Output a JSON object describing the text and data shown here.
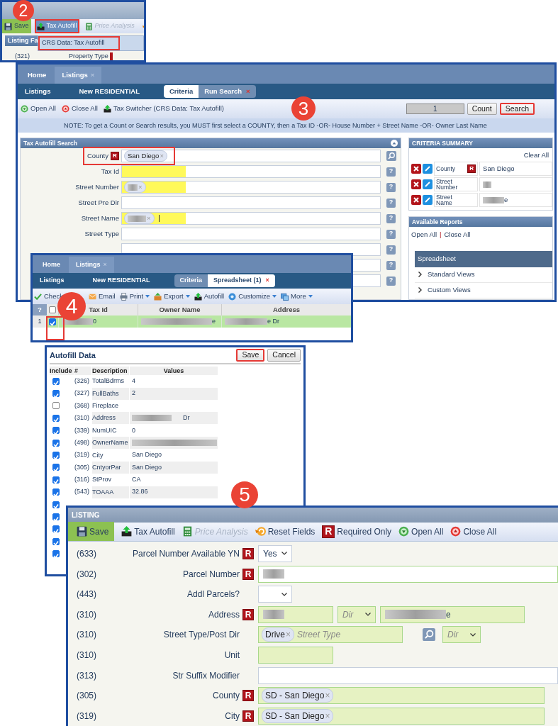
{
  "step_badges": [
    {
      "label": "2"
    },
    {
      "label": "3"
    },
    {
      "label": "4"
    },
    {
      "label": "5"
    }
  ],
  "menu_window": {
    "toolbar": [
      {
        "kind": "save",
        "label": "Save",
        "highlighted": false,
        "disabled": false
      },
      {
        "kind": "autofill",
        "label": "Tax Autofill",
        "highlighted": true,
        "disabled": false
      },
      {
        "kind": "price",
        "label": "Price Analysis",
        "highlighted": false,
        "disabled": true
      },
      {
        "kind": "reset"
      }
    ],
    "section_title": "Listing Fa",
    "menu_item": {
      "label": "CRS Data: Tax Autofill",
      "highlighted": true
    },
    "field": {
      "number": "(321)",
      "label": "Property Type"
    }
  },
  "search_window": {
    "tabs": [
      {
        "label": "Home",
        "selected": false
      },
      {
        "label": "Listings",
        "selected": true,
        "close": "×"
      }
    ],
    "subnav": [
      "Listings",
      "New RESIDENTIAL"
    ],
    "view_tabs": [
      {
        "label": "Criteria",
        "selected": true
      },
      {
        "label": "Run Search",
        "selected": false,
        "close": "×"
      }
    ],
    "toolbar": [
      {
        "kind": "open",
        "label": "Open All"
      },
      {
        "kind": "close",
        "label": "Close All"
      },
      {
        "kind": "autofill",
        "label": "Tax Switcher (CRS Data: Tax Autofill)"
      }
    ],
    "count_value": "1",
    "count_button": {
      "label": "Count",
      "highlighted": false
    },
    "search_button": {
      "label": "Search",
      "highlighted": true
    },
    "note": "NOTE: To get a Count or Search results, you MUST first select a COUNTY, then a Tax ID -OR- House Number + Street Name -OR- Owner Last Name",
    "form": {
      "title": "Tax Autofill Search",
      "fields": [
        {
          "label": "County",
          "badge": "R",
          "kind": "lookup",
          "chip": {
            "text": "San Diego",
            "remove": "×"
          },
          "highlighted": true,
          "marked": false
        },
        {
          "label": "Tax Id",
          "kind": "help",
          "help": "?",
          "highlighted": false,
          "marked": true
        },
        {
          "label": "Street Number",
          "kind": "help",
          "help": "?",
          "chip": {
            "redacted": true,
            "remove": "×"
          },
          "highlighted": false,
          "marked": true
        },
        {
          "label": "Street Pre Dir",
          "kind": "help",
          "help": "?",
          "highlighted": false,
          "marked": false
        },
        {
          "label": "Street Name",
          "kind": "help",
          "help": "?",
          "chip": {
            "redacted": true,
            "remove": "×"
          },
          "cursor": true,
          "highlighted": false,
          "marked": true
        },
        {
          "label": "Street Type",
          "kind": "help",
          "help": "?",
          "highlighted": false,
          "marked": false
        },
        {
          "kind": "help",
          "help": "?",
          "highlighted": false,
          "marked": false
        },
        {
          "kind": "help",
          "help": "?"
        },
        {
          "kind": "help",
          "help": "?"
        }
      ]
    },
    "summary": {
      "title": "CRITERIA SUMMARY",
      "clear": "Clear All",
      "rows": [
        {
          "label": "County",
          "badge": "R",
          "value": "San Diego"
        },
        {
          "label": "Street Number",
          "redacted": true
        },
        {
          "label": "Street Name",
          "redacted": true,
          "value": "e"
        }
      ]
    },
    "reports": {
      "title": "Available Reports",
      "links": [
        "Open All",
        "Close All"
      ],
      "separator": "|",
      "group": "Spreadsheet",
      "items": [
        "Standard Views",
        "Custom Views"
      ]
    }
  },
  "spreadsheet_window": {
    "tabs": [
      {
        "label": "Home",
        "selected": false
      },
      {
        "label": "Listings",
        "selected": true,
        "close": "×"
      }
    ],
    "subnav": [
      "Listings",
      "New RESIDENTIAL"
    ],
    "view_tabs": [
      {
        "label": "Criteria",
        "selected": false
      },
      {
        "label": "Spreadsheet (1)",
        "selected": true,
        "close": "×"
      }
    ],
    "toolbar": [
      {
        "kind": "check",
        "label": "Check"
      },
      {
        "kind": "email",
        "label": "Email"
      },
      {
        "kind": "print",
        "label": "Print",
        "dropdown": true
      },
      {
        "kind": "export",
        "label": "Export",
        "dropdown": true
      },
      {
        "kind": "autofill",
        "label": "Autofill"
      },
      {
        "kind": "customize",
        "label": "Customize",
        "dropdown": true
      },
      {
        "kind": "more",
        "label": "More",
        "dropdown": true
      }
    ],
    "table": {
      "help": "?",
      "all_checked": false,
      "columns": [
        "Tax Id",
        "Owner Name",
        "Address"
      ],
      "rows": [
        {
          "number": "1",
          "checked": true,
          "selected": true,
          "highlighted": true,
          "cells": [
            "0",
            "e",
            "e Dr"
          ]
        }
      ]
    }
  },
  "autofill_dialog": {
    "title": "Autofill Data",
    "save": {
      "label": "Save",
      "highlighted": true
    },
    "cancel": {
      "label": "Cancel",
      "highlighted": false
    },
    "columns": [
      "Include",
      "#",
      "Description",
      "Values"
    ],
    "rows": [
      {
        "checked": true,
        "number": "(326)",
        "description": "TotalBdrms",
        "value": "4"
      },
      {
        "checked": true,
        "number": "(327)",
        "description": "FullBaths",
        "value": "2"
      },
      {
        "checked": false,
        "number": "(368)",
        "description": "Fireplace"
      },
      {
        "checked": true,
        "number": "(310)",
        "description": "Address",
        "redacted": true,
        "value": "Dr"
      },
      {
        "checked": true,
        "number": "(339)",
        "description": "NumUIC",
        "value": "0"
      },
      {
        "checked": true,
        "number": "(498)",
        "description": "OwnerName",
        "redacted": true
      },
      {
        "checked": true,
        "number": "(319)",
        "description": "City",
        "value": "San Diego"
      },
      {
        "checked": true,
        "number": "(305)",
        "description": "CntyorPar",
        "value": "San Diego"
      },
      {
        "checked": true,
        "number": "(316)",
        "description": "StProv",
        "value": "CA"
      },
      {
        "checked": true,
        "number": "(543)",
        "description": "TOAAA",
        "value": "32.86"
      },
      {
        "checked": true
      },
      {
        "checked": true
      },
      {
        "checked": true
      },
      {
        "checked": true
      },
      {
        "checked": true
      }
    ]
  },
  "listing_window": {
    "title": "LISTING",
    "toolbar": [
      {
        "kind": "save",
        "label": "Save",
        "disabled": false
      },
      {
        "kind": "autofill",
        "label": "Tax Autofill",
        "disabled": false
      },
      {
        "kind": "price",
        "label": "Price Analysis",
        "disabled": true
      },
      {
        "kind": "reset",
        "label": "Reset Fields",
        "disabled": false
      },
      {
        "kind": "required",
        "badge": "R",
        "label": "Required Only",
        "disabled": false
      },
      {
        "kind": "open",
        "label": "Open All",
        "disabled": false
      },
      {
        "kind": "close",
        "label": "Close All",
        "disabled": false
      }
    ],
    "fields": [
      {
        "number": "(633)",
        "label": "Parcel Number Available YN",
        "badge": "R",
        "controls": [
          {
            "kind": "select",
            "value": "Yes",
            "filled": false
          }
        ]
      },
      {
        "number": "(302)",
        "label": "Parcel Number",
        "badge": "R",
        "controls": [
          {
            "kind": "input",
            "redacted": true,
            "filled": false
          }
        ]
      },
      {
        "number": "(443)",
        "label": "Addl Parcels?",
        "controls": [
          {
            "kind": "select",
            "filled": false
          }
        ]
      },
      {
        "number": "(310)",
        "label": "Address",
        "badge": "R",
        "controls": [
          {
            "kind": "input",
            "redacted": true,
            "filled": true
          },
          {
            "kind": "select",
            "placeholder": "Dir",
            "filled": true
          },
          {
            "kind": "input",
            "redacted": true,
            "value": "e",
            "filled": true
          }
        ]
      },
      {
        "number": "(310)",
        "label": "Street Type/Post Dir",
        "controls": [
          {
            "kind": "chips",
            "chip": "Drive",
            "remove": "×",
            "placeholder": "Street Type",
            "filled": true
          },
          {
            "kind": "lookup"
          },
          {
            "kind": "select",
            "placeholder": "Dir",
            "filled": true
          }
        ]
      },
      {
        "number": "(310)",
        "label": "Unit",
        "controls": [
          {
            "kind": "input",
            "filled": true
          }
        ]
      },
      {
        "number": "(313)",
        "label": "Str Suffix Modifier",
        "controls": [
          {
            "kind": "input",
            "filled": false
          }
        ]
      },
      {
        "number": "(305)",
        "label": "County",
        "badge": "R",
        "controls": [
          {
            "kind": "chips",
            "chip": "SD - San Diego",
            "remove": "×",
            "filled": true
          }
        ]
      },
      {
        "number": "(319)",
        "label": "City",
        "badge": "R",
        "controls": [
          {
            "kind": "chips",
            "chip": "SD - San Diego",
            "remove": "×",
            "filled": true
          }
        ]
      }
    ]
  }
}
